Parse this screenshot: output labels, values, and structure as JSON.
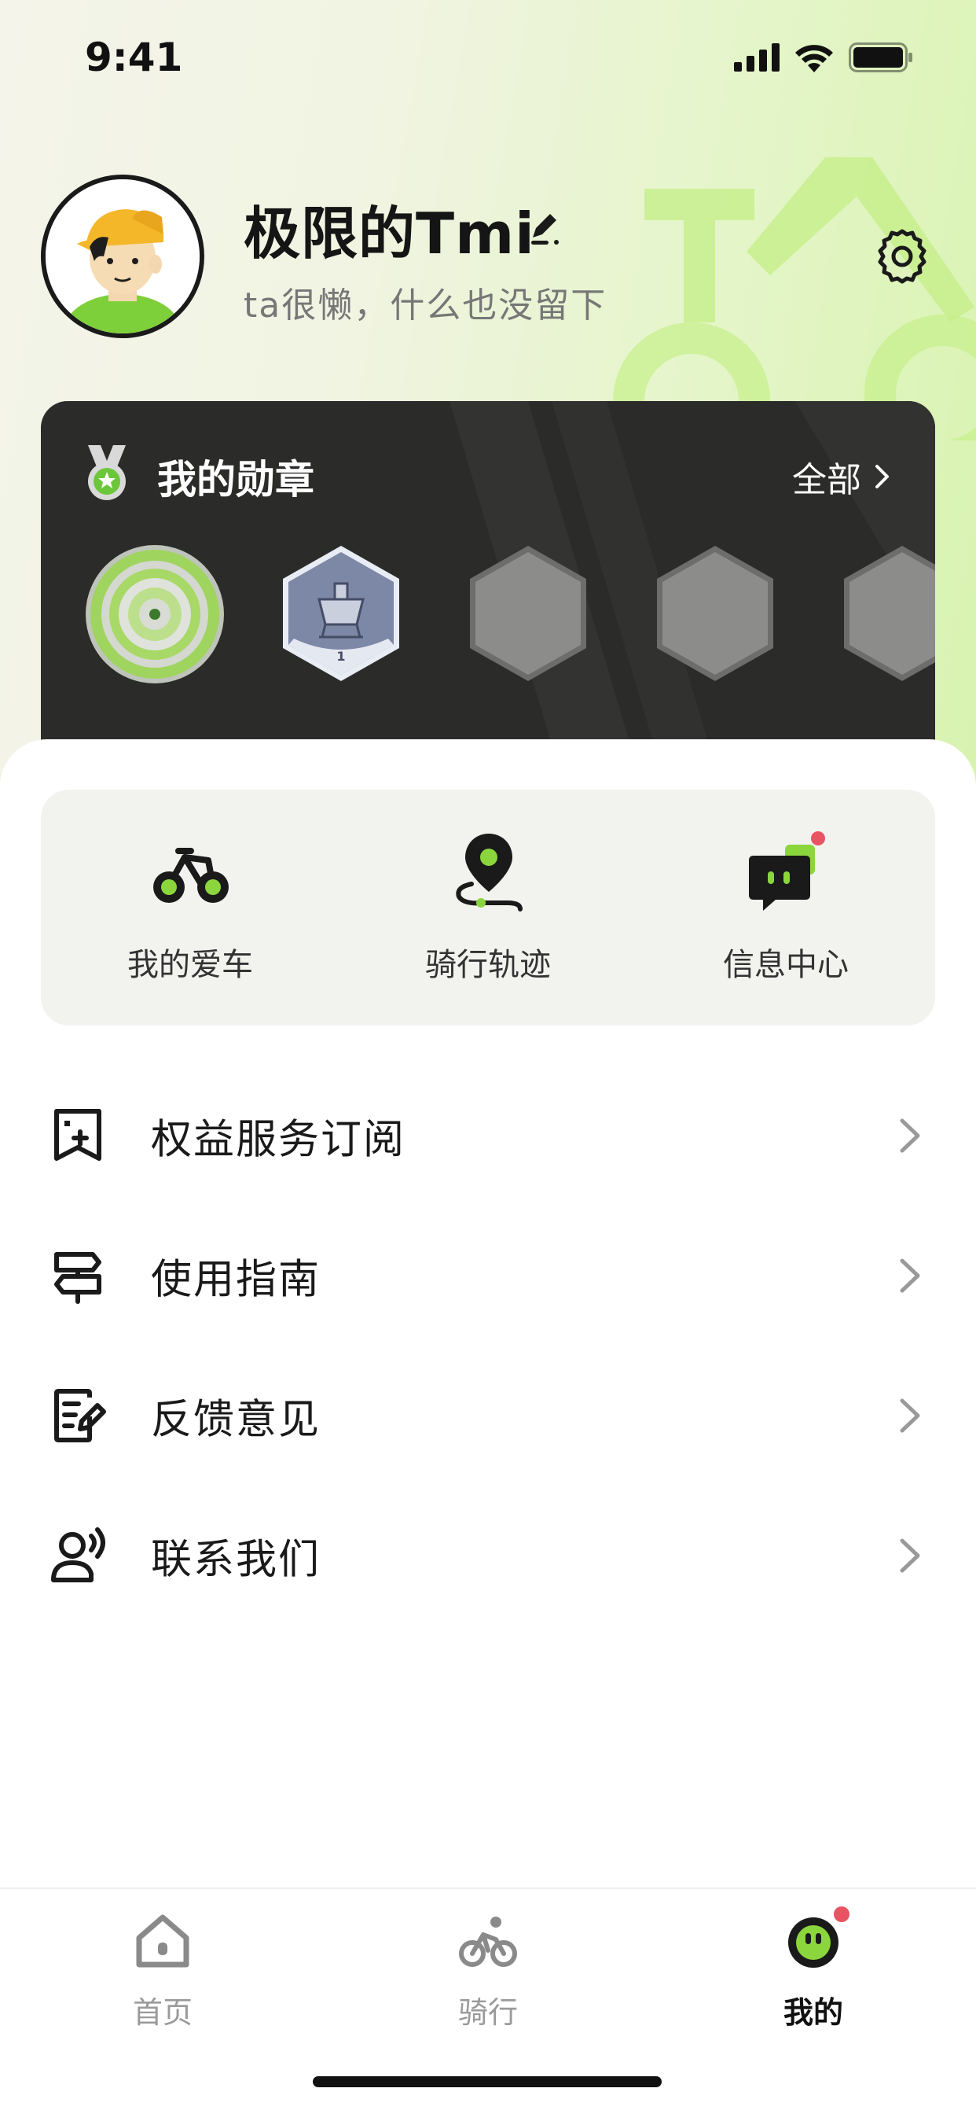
{
  "status_bar": {
    "time": "9:41"
  },
  "profile": {
    "nickname": "极限的Tmi",
    "bio": "ta很懒，什么也没留下"
  },
  "medals": {
    "title": "我的勋章",
    "all_label": "全部",
    "items": [
      {
        "name": "medal-green-ring",
        "state": "earned"
      },
      {
        "name": "medal-silver-1",
        "state": "earned",
        "level": "1"
      },
      {
        "name": "medal-locked",
        "state": "locked"
      },
      {
        "name": "medal-locked",
        "state": "locked"
      },
      {
        "name": "medal-locked",
        "state": "locked"
      }
    ]
  },
  "quick_actions": [
    {
      "label": "我的爱车",
      "icon": "bicycle-icon"
    },
    {
      "label": "骑行轨迹",
      "icon": "route-pin-icon"
    },
    {
      "label": "信息中心",
      "icon": "message-center-icon",
      "badge": true
    }
  ],
  "menu": [
    {
      "label": "权益服务订阅",
      "icon": "subscription-icon"
    },
    {
      "label": "使用指南",
      "icon": "signpost-icon"
    },
    {
      "label": "反馈意见",
      "icon": "feedback-icon"
    },
    {
      "label": "联系我们",
      "icon": "contact-icon"
    }
  ],
  "tabbar": {
    "tabs": [
      {
        "label": "首页",
        "icon": "home-icon",
        "active": false
      },
      {
        "label": "骑行",
        "icon": "riding-icon",
        "active": false
      },
      {
        "label": "我的",
        "icon": "profile-face-icon",
        "active": true,
        "badge": true
      }
    ]
  },
  "colors": {
    "accent_green": "#8bd63c",
    "dark_card": "#2b2b2a",
    "badge_red": "#e85462",
    "panel_gray": "#f2f3ef"
  }
}
